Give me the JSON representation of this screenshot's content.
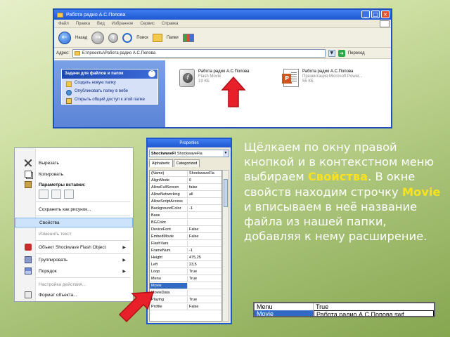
{
  "explorer": {
    "title": "Работа радио А.С.Попова",
    "window_buttons": [
      "_",
      "□",
      "×"
    ],
    "menu": [
      "Файл",
      "Правка",
      "Вид",
      "Избранное",
      "Сервис",
      "Справка"
    ],
    "toolbar": {
      "back": "Назад",
      "search": "Поиск",
      "folders": "Папки"
    },
    "address_label": "Адрес:",
    "address_value": "E:\\проекты\\Работа радио А.С.Попова",
    "go_label": "Переход",
    "task_pane": {
      "header": "Задачи для файлов и папок",
      "items": [
        "Создать новую папку",
        "Опубликовать папку в вебе",
        "Открыть общий доступ к этой папке"
      ]
    },
    "files": [
      {
        "name": "Работа радио А.С.Попова",
        "type": "Flash Movie",
        "size": "19 КБ"
      },
      {
        "name": "Работа радио А.С.Попова",
        "type": "Презентация Microsoft Power...",
        "size": "55 КБ"
      }
    ]
  },
  "context_menu": {
    "items": [
      {
        "label": "Вырезать",
        "icon": "scissors-icon"
      },
      {
        "label": "Копировать",
        "icon": "copy-icon"
      },
      {
        "label": "Параметры вставки:",
        "icon": "paste-icon"
      },
      {
        "label": "Сохранить как рисунок...",
        "icon": ""
      },
      {
        "label": "Свойства",
        "icon": "",
        "selected": true
      },
      {
        "label": "Изменить текст",
        "icon": "",
        "dim": true
      },
      {
        "label": "Объект Shockwave Flash Object",
        "icon": "shockwave-icon",
        "submenu": true
      },
      {
        "label": "Группировать",
        "icon": "group-icon",
        "submenu": true
      },
      {
        "label": "Порядок",
        "icon": "order-icon",
        "submenu": true
      },
      {
        "label": "Настройка действия...",
        "icon": "",
        "dim": true
      },
      {
        "label": "Формат объекта...",
        "icon": "format-icon"
      }
    ]
  },
  "properties": {
    "title": "Properties",
    "object_name": "ShockwaveFl",
    "object_type": "ShockwaveFla",
    "tabs": [
      "Alphabetic",
      "Categorized"
    ],
    "rows": [
      {
        "k": "(Name)",
        "v": "ShockwaveFla"
      },
      {
        "k": "AlignMode",
        "v": "0"
      },
      {
        "k": "AllowFullScreen",
        "v": "false"
      },
      {
        "k": "AllowNetworking",
        "v": "all"
      },
      {
        "k": "AllowScriptAccess",
        "v": ""
      },
      {
        "k": "BackgroundColor",
        "v": "-1"
      },
      {
        "k": "Base",
        "v": ""
      },
      {
        "k": "BGColor",
        "v": ""
      },
      {
        "k": "DeviceFont",
        "v": "False"
      },
      {
        "k": "EmbedMovie",
        "v": "False"
      },
      {
        "k": "FlashVars",
        "v": ""
      },
      {
        "k": "FrameNum",
        "v": "-1"
      },
      {
        "k": "Height",
        "v": "475,25"
      },
      {
        "k": "Left",
        "v": "23,5"
      },
      {
        "k": "Loop",
        "v": "True"
      },
      {
        "k": "Menu",
        "v": "True"
      },
      {
        "k": "Movie",
        "v": "",
        "selected": true
      },
      {
        "k": "MovieData",
        "v": ""
      },
      {
        "k": "Playing",
        "v": "True"
      },
      {
        "k": "Profile",
        "v": "False"
      }
    ]
  },
  "description": {
    "part1": "Щёлкаем по окну правой кнопкой и в контекстном меню выбираем ",
    "highlight1": "Свойства",
    "part2": ". В окне свойств находим строчку ",
    "highlight2": "Movie",
    "part3": " и вписываем в неё название файла из нашей папки, добавляя к нему расширение."
  },
  "zoom": {
    "menu_key": "Menu",
    "menu_value": "True",
    "movie_key": "Movie",
    "movie_value": "Работа радио А.С.Попова.swf"
  },
  "colors": {
    "arrow": "#e8202a",
    "highlight": "#f8e21e",
    "text": "#ffffff"
  }
}
